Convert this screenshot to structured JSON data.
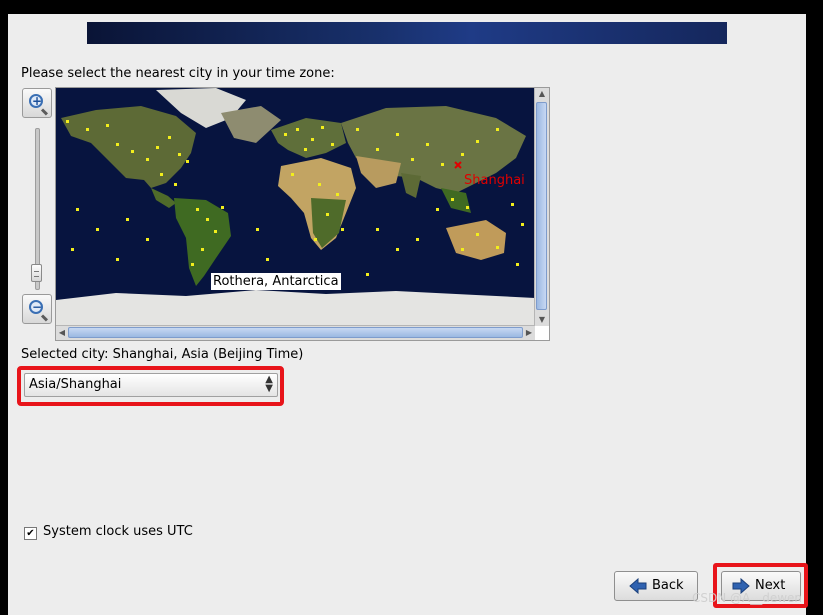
{
  "header": {
    "prompt": "Please select the nearest city in your time zone:"
  },
  "map": {
    "selected_city_label": "Shanghai",
    "hover_label": "Rothera, Antarctica",
    "colors": {
      "ocean": "#06123e",
      "city_dot": "#f2ee1c",
      "selected": "#e00000"
    }
  },
  "selection": {
    "text": "Selected city: Shanghai, Asia (Beijing Time)",
    "timezone_value": "Asia/Shanghai"
  },
  "options": {
    "utc_label": "System clock uses UTC",
    "utc_checked": true
  },
  "buttons": {
    "back_label": "Back",
    "next_label": "Next"
  },
  "watermark": "CSDN @A__dewen",
  "icons": {
    "zoom_in": "zoom-in-icon",
    "zoom_out": "zoom-out-icon",
    "back": "arrow-left-icon",
    "next": "arrow-right-icon"
  }
}
